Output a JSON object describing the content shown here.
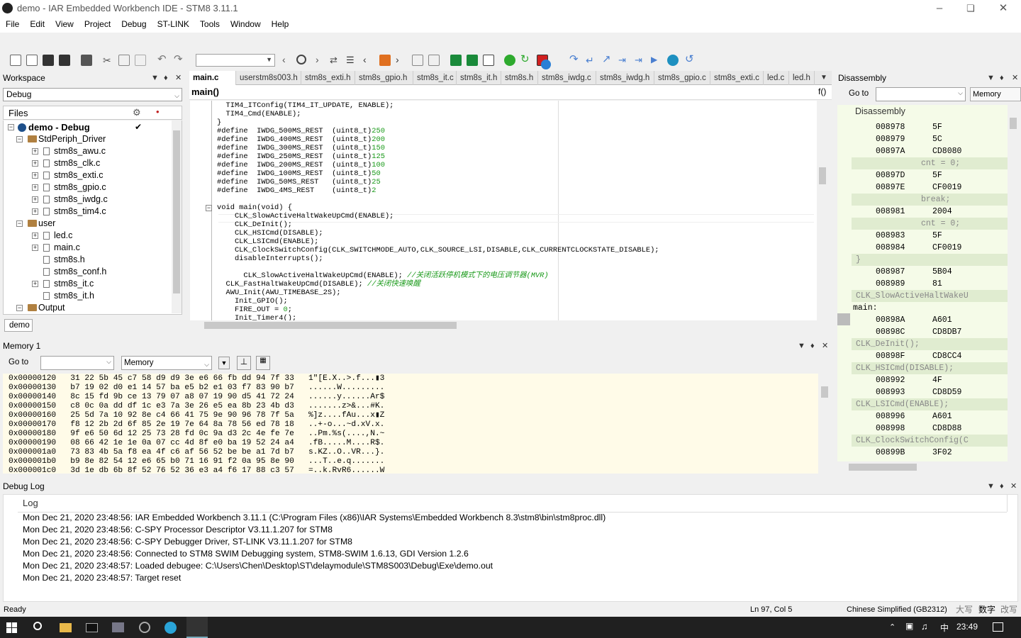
{
  "app": {
    "title": "demo - IAR Embedded Workbench IDE - STM8 3.11.1"
  },
  "menu": [
    "File",
    "Edit",
    "View",
    "Project",
    "Debug",
    "ST-LINK",
    "Tools",
    "Window",
    "Help"
  ],
  "workspace": {
    "title": "Workspace",
    "config": "Debug",
    "files_header": "Files",
    "root": "demo - Debug",
    "tree": [
      {
        "label": "StdPeriph_Driver",
        "type": "folder",
        "level": 1
      },
      {
        "label": "stm8s_awu.c",
        "type": "file",
        "level": 2,
        "expand": true
      },
      {
        "label": "stm8s_clk.c",
        "type": "file",
        "level": 2,
        "expand": true
      },
      {
        "label": "stm8s_exti.c",
        "type": "file",
        "level": 2,
        "expand": true
      },
      {
        "label": "stm8s_gpio.c",
        "type": "file",
        "level": 2,
        "expand": true
      },
      {
        "label": "stm8s_iwdg.c",
        "type": "file",
        "level": 2,
        "expand": true
      },
      {
        "label": "stm8s_tim4.c",
        "type": "file",
        "level": 2,
        "expand": true
      },
      {
        "label": "user",
        "type": "folder",
        "level": 1
      },
      {
        "label": "led.c",
        "type": "file",
        "level": 2,
        "expand": true
      },
      {
        "label": "main.c",
        "type": "file",
        "level": 2,
        "expand": true
      },
      {
        "label": "stm8s.h",
        "type": "file",
        "level": 2,
        "expand": false
      },
      {
        "label": "stm8s_conf.h",
        "type": "file",
        "level": 2,
        "expand": false
      },
      {
        "label": "stm8s_it.c",
        "type": "file",
        "level": 2,
        "expand": true
      },
      {
        "label": "stm8s_it.h",
        "type": "file",
        "level": 2,
        "expand": false
      },
      {
        "label": "Output",
        "type": "folder",
        "level": 1
      }
    ],
    "bottom_tab": "demo"
  },
  "editor": {
    "tabs": [
      "main.c",
      "userstm8s003.h",
      "stm8s_exti.h",
      "stm8s_gpio.h",
      "stm8s_it.c",
      "stm8s_it.h",
      "stm8s.h",
      "stm8s_iwdg.c",
      "stm8s_iwdg.h",
      "stm8s_gpio.c",
      "stm8s_exti.c",
      "led.c",
      "led.h"
    ],
    "function": "main()",
    "func_btn": "f()",
    "lines": [
      "  TIM4_ITConfig(TIM4_IT_UPDATE, ENABLE);",
      "  TIM4_Cmd(ENABLE);",
      "}",
      "#define  IWDG_500MS_REST  (uint8_t)250",
      "#define  IWDG_400MS_REST  (uint8_t)200",
      "#define  IWDG_300MS_REST  (uint8_t)150",
      "#define  IWDG_250MS_REST  (uint8_t)125",
      "#define  IWDG_200MS_REST  (uint8_t)100",
      "#define  IWDG_100MS_REST  (uint8_t)50",
      "#define  IWDG_50MS_REST   (uint8_t)25",
      "#define  IWDG_4MS_REST    (uint8_t)2",
      "",
      "void main(void) {",
      "    CLK_SlowActiveHaltWakeUpCmd(ENABLE);",
      "    CLK_DeInit();",
      "    CLK_HSICmd(DISABLE);",
      "    CLK_LSICmd(ENABLE);",
      "    CLK_ClockSwitchConfig(CLK_SWITCHMODE_AUTO,CLK_SOURCE_LSI,DISABLE,CLK_CURRENTCLOCKSTATE_DISABLE);",
      "    disableInterrupts();",
      "",
      "      CLK_SlowActiveHaltWakeUpCmd(ENABLE); //关闭活跃停机模式下的电压调节器(MVR)",
      "  CLK_FastHaltWakeUpCmd(DISABLE); //关闭快速唤醒",
      "  AWU_Init(AWU_TIMEBASE_2S);",
      "    Init_GPIO();",
      "    FIRE_OUT = 0;",
      "    Init_Timer4();"
    ]
  },
  "disassembly": {
    "title": "Disassembly",
    "goto_label": "Go to",
    "memory_btn": "Memory",
    "header": "Disassembly",
    "rows": [
      {
        "addr": "008978",
        "code": "5F"
      },
      {
        "addr": "008979",
        "code": "5C"
      },
      {
        "addr": "00897A",
        "code": "CD8080"
      },
      {
        "src": "cnt = 0;"
      },
      {
        "addr": "00897D",
        "code": "5F"
      },
      {
        "addr": "00897E",
        "code": "CF0019"
      },
      {
        "src": "break;"
      },
      {
        "addr": "008981",
        "code": "2004"
      },
      {
        "src": "cnt = 0;"
      },
      {
        "addr": "008983",
        "code": "5F"
      },
      {
        "addr": "008984",
        "code": "CF0019"
      },
      {
        "brace": "}"
      },
      {
        "addr": "008987",
        "code": "5B04"
      },
      {
        "addr": "008989",
        "code": "81"
      },
      {
        "src": "CLK_SlowActiveHaltWakeU"
      },
      {
        "label": "main:"
      },
      {
        "addr": "00898A",
        "code": "A601"
      },
      {
        "addr": "00898C",
        "code": "CD8DB7"
      },
      {
        "src": "CLK_DeInit();"
      },
      {
        "addr": "00898F",
        "code": "CD8CC4"
      },
      {
        "src": "CLK_HSICmd(DISABLE);"
      },
      {
        "addr": "008992",
        "code": "4F"
      },
      {
        "addr": "008993",
        "code": "CD8D59"
      },
      {
        "src": "CLK_LSICmd(ENABLE);"
      },
      {
        "addr": "008996",
        "code": "A601"
      },
      {
        "addr": "008998",
        "code": "CD8D88"
      },
      {
        "src": "CLK_ClockSwitchConfig(C"
      },
      {
        "addr": "00899B",
        "code": "3F02"
      }
    ]
  },
  "memory": {
    "title": "Memory 1",
    "goto_label": "Go to",
    "zone": "Memory",
    "rows": [
      "0x00000120   31 22 5b 45 c7 58 d9 d9 3e e6 66 fb dd 94 7f 33   1\"[E.X..>.f...▮3",
      "0x00000130   b7 19 02 d0 e1 14 57 ba e5 b2 e1 03 f7 83 90 b7   ......W.........",
      "0x00000140   8c 15 fd 9b ce 13 79 07 a8 07 19 90 d5 41 72 24   ......y......Ar$",
      "0x00000150   c8 0c 0a dd df 1c e3 7a 3e 26 e5 ea 8b 23 4b d3   .......z>&...#K.",
      "0x00000160   25 5d 7a 10 92 8e c4 66 41 75 9e 90 96 78 7f 5a   %]z....fAu...x▮Z",
      "0x00000170   f8 12 2b 2d 6f 85 2e 19 7e 64 8a 78 56 ed 78 18   ..+-o...~d.xV.x.",
      "0x00000180   9f e6 50 6d 12 25 73 28 fd 0c 9a d3 2c 4e fe 7e   ..Pm.%s(....,N.~",
      "0x00000190   08 66 42 1e 1e 0a 07 cc 4d 8f e0 ba 19 52 24 a4   .fB.....M....R$.",
      "0x000001a0   73 83 4b 5a f8 ea 4f c6 af 56 52 be be a1 7d b7   s.KZ..O..VR...}.",
      "0x000001b0   b9 8e 82 54 12 e6 65 b0 71 16 91 f2 0a 95 8e 90   ...T..e.q.......",
      "0x000001c0   3d 1e db 6b 8f 52 76 52 36 e3 a4 f6 17 88 c3 57   =..k.RvR6......W"
    ]
  },
  "debuglog": {
    "title": "Debug Log",
    "header": "Log",
    "lines": [
      "Mon Dec 21, 2020 23:48:56: IAR Embedded Workbench 3.11.1 (C:\\Program Files (x86)\\IAR Systems\\Embedded Workbench 8.3\\stm8\\bin\\stm8proc.dll)",
      "Mon Dec 21, 2020 23:48:56: C-SPY Processor Descriptor V3.11.1.207 for STM8",
      "Mon Dec 21, 2020 23:48:56: C-SPY Debugger Driver, ST-LINK V3.11.1.207 for STM8",
      "Mon Dec 21, 2020 23:48:56: Connected to STM8 SWIM Debugging system, STM8-SWIM 1.6.13, GDI Version 1.2.6",
      "Mon Dec 21, 2020 23:48:57: Loaded debugee: C:\\Users\\Chen\\Desktop\\ST\\delaymodule\\STM8S003\\Debug\\Exe\\demo.out",
      "Mon Dec 21, 2020 23:48:57: Target reset"
    ]
  },
  "status": {
    "ready": "Ready",
    "pos": "Ln 97, Col 5",
    "encoding": "Chinese Simplified (GB2312)",
    "caps": "大写",
    "num": "数字",
    "ovr": "改写"
  },
  "taskbar": {
    "time": "23:49",
    "ime": "中"
  }
}
